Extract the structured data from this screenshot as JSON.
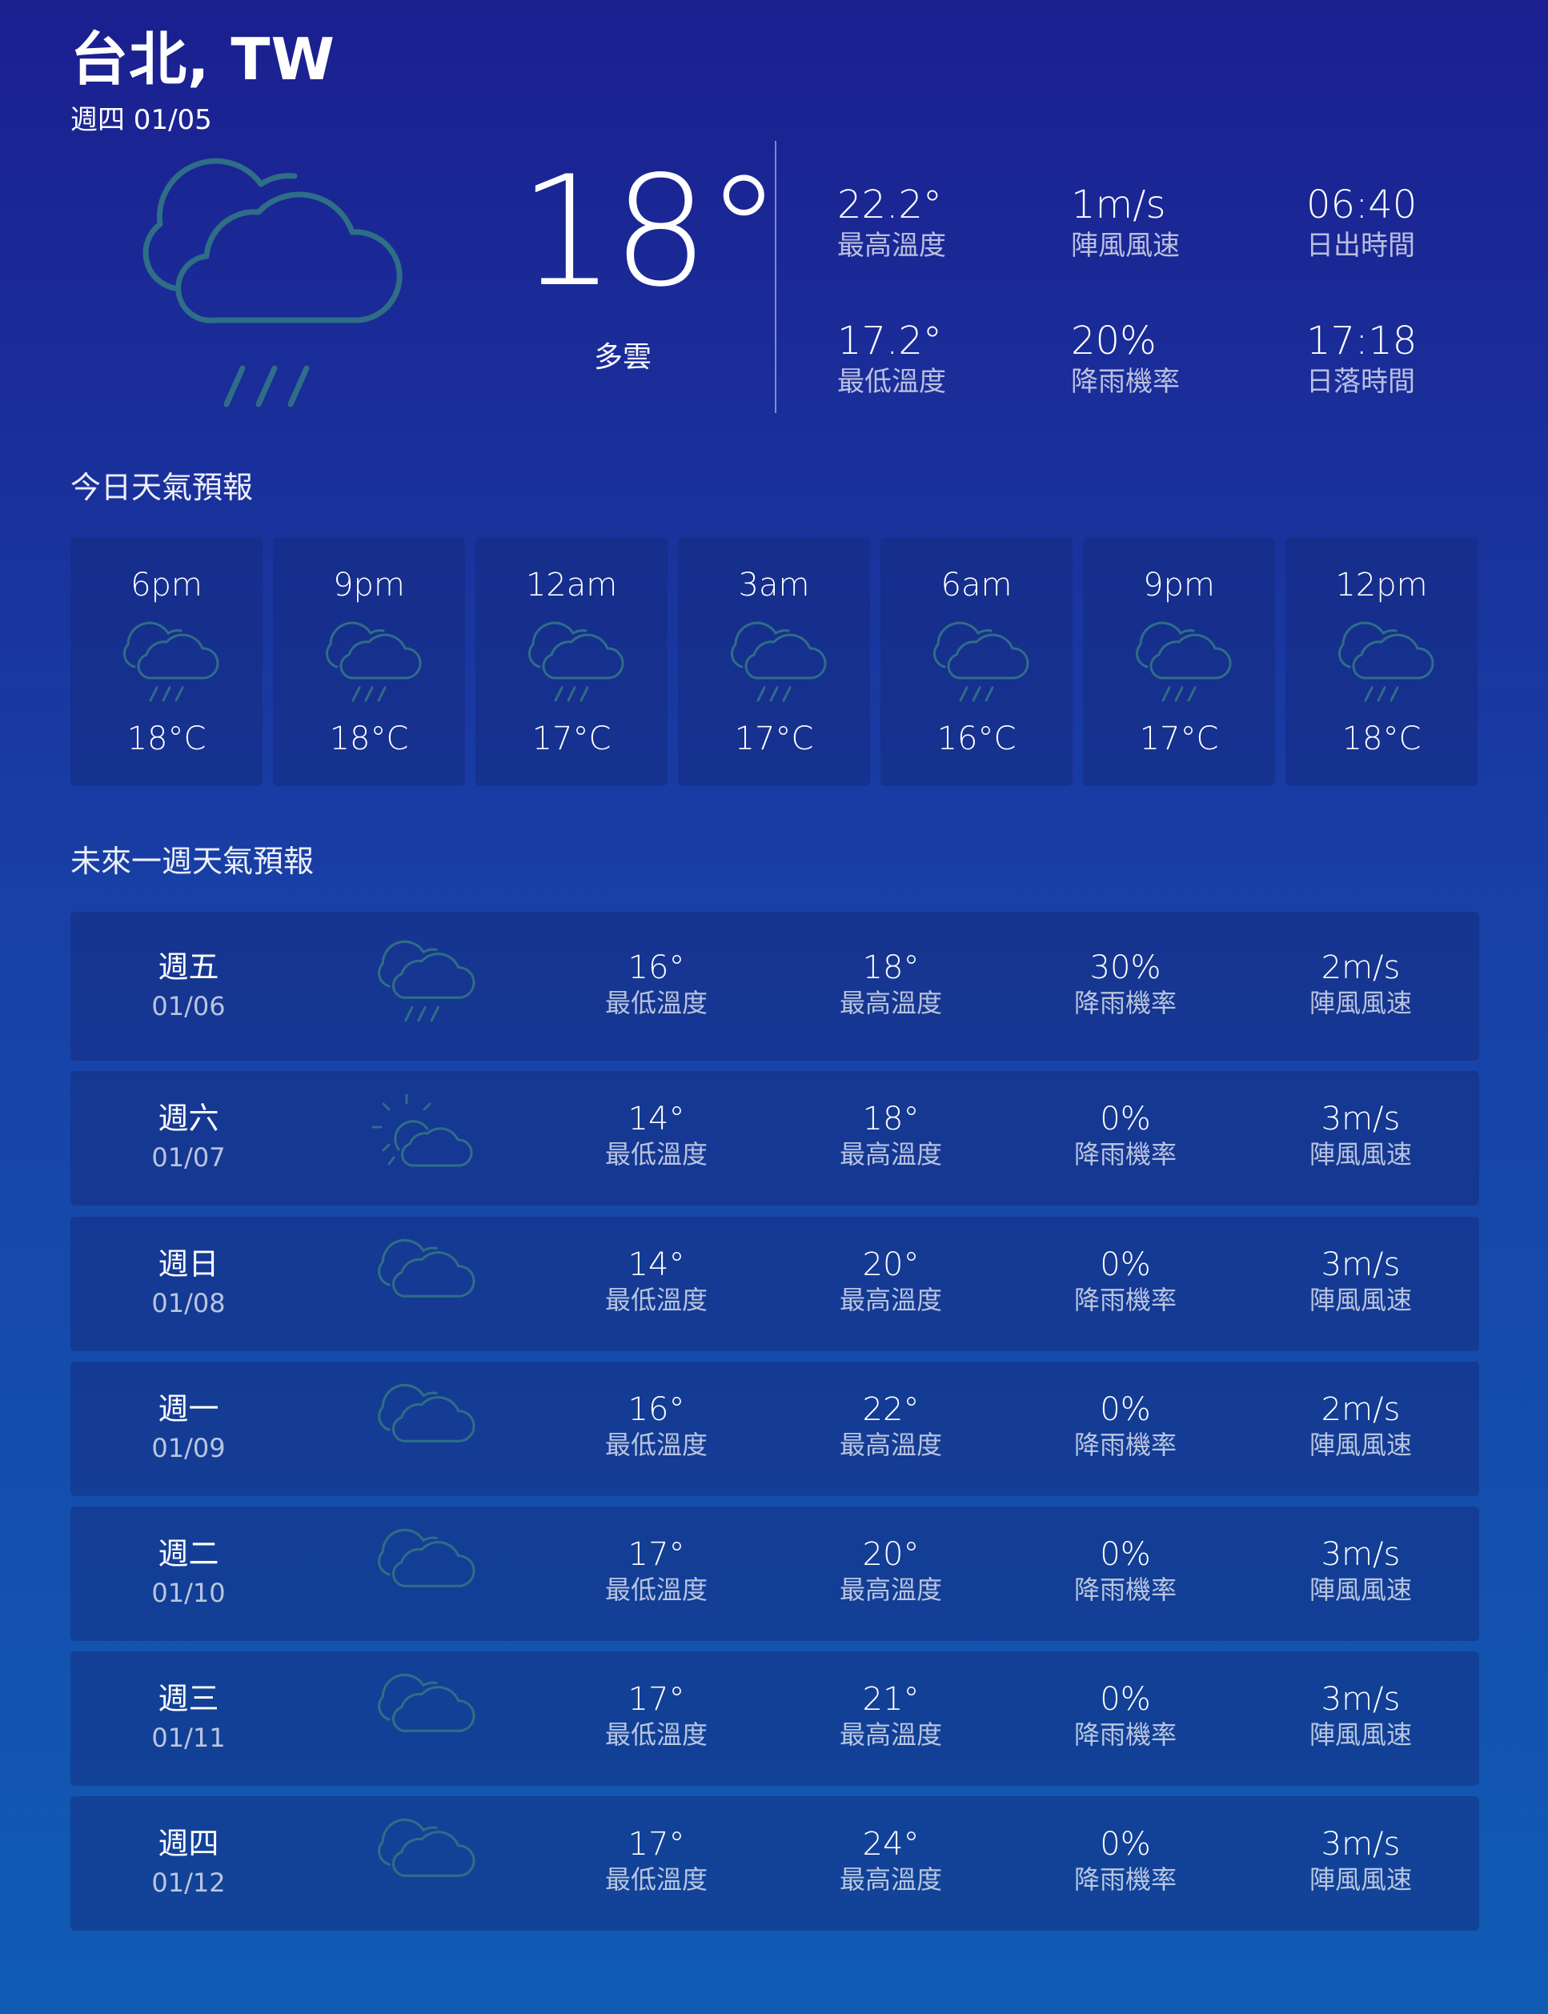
{
  "header": {
    "city": "台北, TW",
    "date": "週四 01/05"
  },
  "current": {
    "icon": "cloud-rain-icon",
    "temperature": "18°",
    "condition": "多雲",
    "stats": [
      {
        "value": "22.2°",
        "label": "最高溫度"
      },
      {
        "value": "1m/s",
        "label": "陣風風速"
      },
      {
        "value": "06:40",
        "label": "日出時間"
      },
      {
        "value": "17.2°",
        "label": "最低溫度"
      },
      {
        "value": "20%",
        "label": "降雨機率"
      },
      {
        "value": "17:18",
        "label": "日落時間"
      }
    ]
  },
  "today": {
    "title": "今日天氣預報",
    "hours": [
      {
        "time": "6pm",
        "temp": "18°C",
        "icon": "cloud-rain-icon"
      },
      {
        "time": "9pm",
        "temp": "18°C",
        "icon": "cloud-rain-icon"
      },
      {
        "time": "12am",
        "temp": "17°C",
        "icon": "cloud-rain-icon"
      },
      {
        "time": "3am",
        "temp": "17°C",
        "icon": "cloud-rain-icon"
      },
      {
        "time": "6am",
        "temp": "16°C",
        "icon": "cloud-rain-icon"
      },
      {
        "time": "9pm",
        "temp": "17°C",
        "icon": "cloud-rain-icon"
      },
      {
        "time": "12pm",
        "temp": "18°C",
        "icon": "cloud-rain-icon"
      }
    ]
  },
  "week": {
    "title": "未來一週天氣預報",
    "days": [
      {
        "day": "週五",
        "date": "01/06",
        "icon": "cloud-rain-icon",
        "low": "16°",
        "low_label": "最低溫度",
        "high": "18°",
        "high_label": "最高溫度",
        "rain": "30%",
        "rain_label": "降雨機率",
        "wind": "2m/s",
        "wind_label": "陣風風速"
      },
      {
        "day": "週六",
        "date": "01/07",
        "icon": "sun-cloud-icon",
        "low": "14°",
        "low_label": "最低溫度",
        "high": "18°",
        "high_label": "最高溫度",
        "rain": "0%",
        "rain_label": "降雨機率",
        "wind": "3m/s",
        "wind_label": "陣風風速"
      },
      {
        "day": "週日",
        "date": "01/08",
        "icon": "cloud-icon",
        "low": "14°",
        "low_label": "最低溫度",
        "high": "20°",
        "high_label": "最高溫度",
        "rain": "0%",
        "rain_label": "降雨機率",
        "wind": "3m/s",
        "wind_label": "陣風風速"
      },
      {
        "day": "週一",
        "date": "01/09",
        "icon": "cloud-icon",
        "low": "16°",
        "low_label": "最低溫度",
        "high": "22°",
        "high_label": "最高溫度",
        "rain": "0%",
        "rain_label": "降雨機率",
        "wind": "2m/s",
        "wind_label": "陣風風速"
      },
      {
        "day": "週二",
        "date": "01/10",
        "icon": "cloud-icon",
        "low": "17°",
        "low_label": "最低溫度",
        "high": "20°",
        "high_label": "最高溫度",
        "rain": "0%",
        "rain_label": "降雨機率",
        "wind": "3m/s",
        "wind_label": "陣風風速"
      },
      {
        "day": "週三",
        "date": "01/11",
        "icon": "cloud-icon",
        "low": "17°",
        "low_label": "最低溫度",
        "high": "21°",
        "high_label": "最高溫度",
        "rain": "0%",
        "rain_label": "降雨機率",
        "wind": "3m/s",
        "wind_label": "陣風風速"
      },
      {
        "day": "週四",
        "date": "01/12",
        "icon": "cloud-icon",
        "low": "17°",
        "low_label": "最低溫度",
        "high": "24°",
        "high_label": "最高溫度",
        "rain": "0%",
        "rain_label": "降雨機率",
        "wind": "3m/s",
        "wind_label": "陣風風速"
      }
    ]
  },
  "colors": {
    "icon_stroke": "#2e6e86",
    "card_bg": "#16307a",
    "background_top": "#1b1f8f",
    "background_bottom": "#105cb4"
  }
}
